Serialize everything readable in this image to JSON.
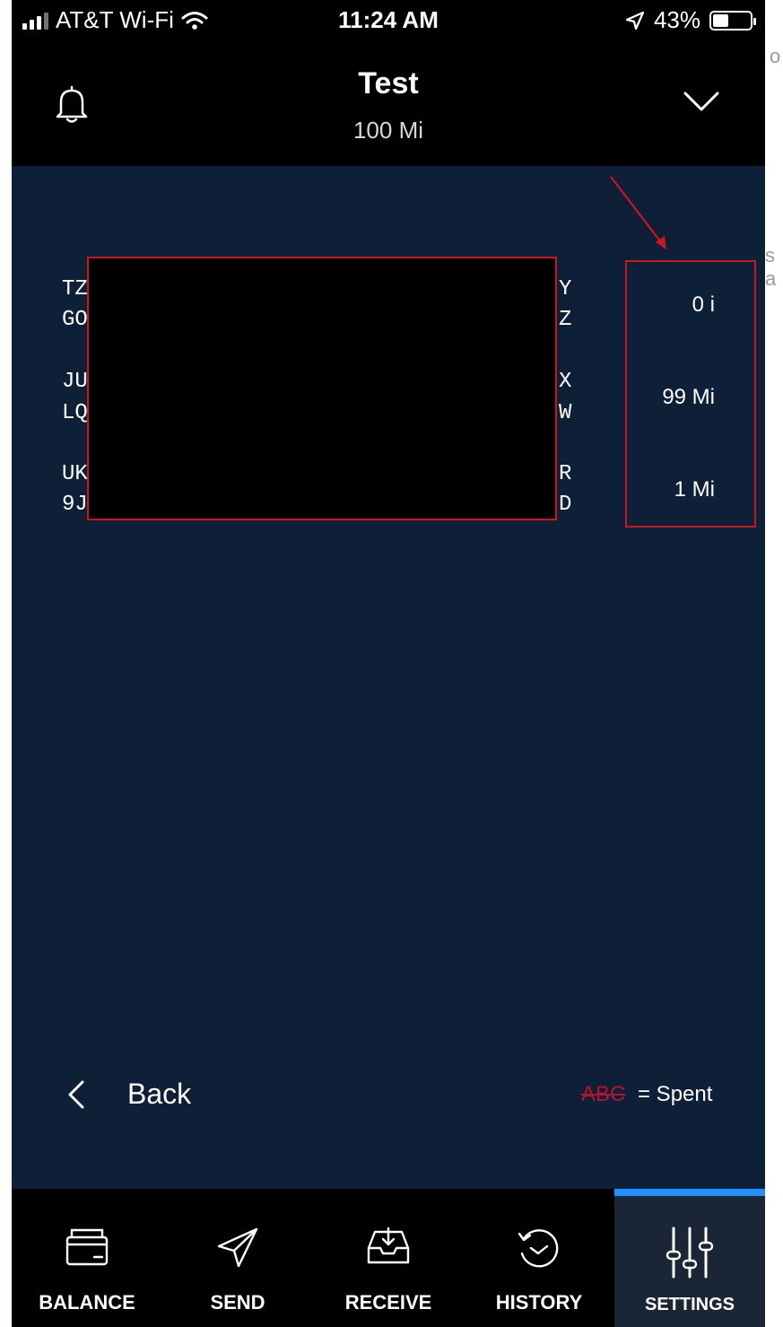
{
  "status_bar": {
    "carrier": "AT&T Wi-Fi",
    "time": "11:24 AM",
    "battery": "43%",
    "battery_level": 0.43
  },
  "header": {
    "title": "Test",
    "subtitle": "100 Mi"
  },
  "rows": [
    {
      "left_top": "TZ",
      "left_bottom": "GO",
      "right_top": "Y",
      "right_bottom": "Z",
      "amount": "0 i"
    },
    {
      "left_top": "JU",
      "left_bottom": "LQ",
      "right_top": "X",
      "right_bottom": "W",
      "amount": "99 Mi"
    },
    {
      "left_top": "UK",
      "left_bottom": "9J",
      "right_top": "R",
      "right_bottom": "D",
      "amount": "1 Mi"
    }
  ],
  "footer": {
    "back_label": "Back",
    "legend_sample": "ABC",
    "legend_text": "= Spent"
  },
  "tabs": [
    {
      "label": "BALANCE",
      "icon": "wallet-icon"
    },
    {
      "label": "SEND",
      "icon": "paper-plane-icon"
    },
    {
      "label": "RECEIVE",
      "icon": "inbox-download-icon"
    },
    {
      "label": "HISTORY",
      "icon": "clock-history-icon"
    },
    {
      "label": "SETTINGS",
      "icon": "sliders-icon",
      "active": true
    }
  ],
  "colors": {
    "background": "#0e1f38",
    "header": "#000000",
    "annotation_red": "#d0141d",
    "spent_red": "#b5152a",
    "active_tab_indicator": "#1e90ff"
  }
}
